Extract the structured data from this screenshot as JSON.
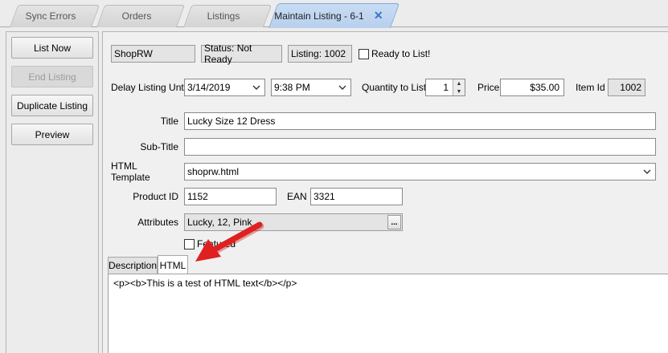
{
  "tabs": [
    {
      "label": "Sync Errors",
      "active": false
    },
    {
      "label": "Orders",
      "active": false
    },
    {
      "label": "Listings",
      "active": false
    },
    {
      "label": "Maintain Listing - 6-1",
      "active": true
    }
  ],
  "actions": {
    "list_now": "List Now",
    "end_listing": "End Listing",
    "duplicate_listing": "Duplicate Listing",
    "preview": "Preview"
  },
  "header": {
    "shop": "ShopRW",
    "status": "Status: Not Ready",
    "listing": "Listing: 1002",
    "ready_label": "Ready to List!",
    "ready_checked": false
  },
  "delay": {
    "label": "Delay Listing Until",
    "date": "3/14/2019",
    "time": "9:38 PM"
  },
  "quantity": {
    "label": "Quantity to List",
    "value": "1"
  },
  "price": {
    "label": "Price",
    "value": "$35.00"
  },
  "item_id": {
    "label": "Item Id",
    "value": "1002"
  },
  "title": {
    "label": "Title",
    "value": "Lucky Size 12 Dress"
  },
  "subtitle": {
    "label": "Sub-Title",
    "value": ""
  },
  "template": {
    "label": "HTML Template",
    "value": "shoprw.html"
  },
  "product_id": {
    "label": "Product ID",
    "value": "1152"
  },
  "ean": {
    "label": "EAN",
    "value": "3321"
  },
  "attributes": {
    "label": "Attributes",
    "value": "Lucky, 12, Pink",
    "button": "..."
  },
  "featured": {
    "label": "Featured",
    "checked": false
  },
  "editor_tabs": [
    {
      "label": "Description",
      "active": false
    },
    {
      "label": "HTML",
      "active": true
    }
  ],
  "editor": {
    "content": "<p><b>This is a test of HTML text</b></p>"
  },
  "colors": {
    "annotation_arrow": "#e02020",
    "active_tab": "#c0d6f1"
  }
}
